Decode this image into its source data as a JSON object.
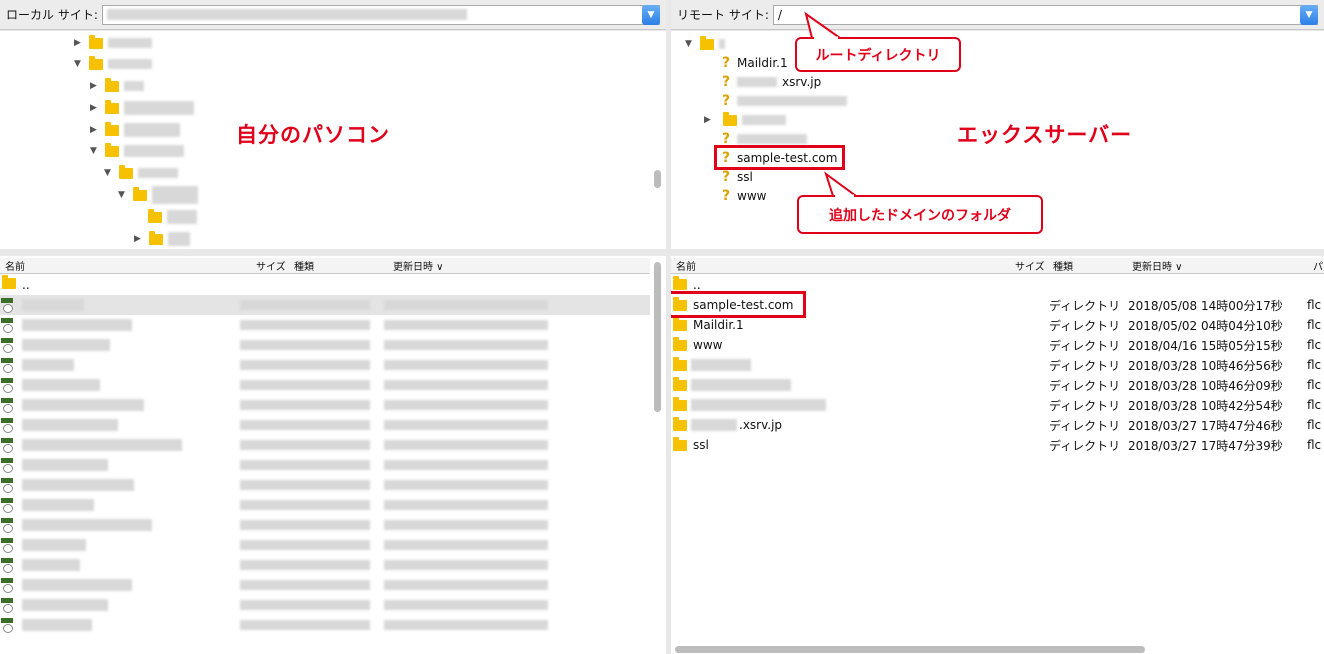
{
  "local": {
    "site_label": "ローカル サイト:",
    "headers": {
      "name": "名前",
      "size": "サイズ",
      "type": "種類",
      "modified": "更新日時 ∨"
    },
    "parent_entry": "..",
    "overlay_label": "自分のパソコン"
  },
  "remote": {
    "site_label": "リモート サイト:",
    "path": "/",
    "tree": [
      {
        "label": "Maildir.1"
      },
      {
        "label": "xsrv.jp"
      },
      {
        "label": "sample-test.com"
      },
      {
        "label": "ssl"
      },
      {
        "label": "www"
      }
    ],
    "headers": {
      "name": "名前",
      "size": "サイズ",
      "type": "種類",
      "modified": "更新日時 ∨",
      "perm": "パ"
    },
    "parent_entry": "..",
    "files": [
      {
        "name": "sample-test.com",
        "type": "ディレクトリ",
        "modified": "2018/05/08 14時00分17秒",
        "owner": "flc"
      },
      {
        "name": "Maildir.1",
        "type": "ディレクトリ",
        "modified": "2018/05/02 04時04分10秒",
        "owner": "flc"
      },
      {
        "name": "www",
        "type": "ディレクトリ",
        "modified": "2018/04/16 15時05分15秒",
        "owner": "flc"
      },
      {
        "name": "",
        "type": "ディレクトリ",
        "modified": "2018/03/28 10時46分56秒",
        "owner": "flc"
      },
      {
        "name": "",
        "type": "ディレクトリ",
        "modified": "2018/03/28 10時46分09秒",
        "owner": "flc"
      },
      {
        "name": "",
        "type": "ディレクトリ",
        "modified": "2018/03/28 10時42分54秒",
        "owner": "flc"
      },
      {
        "name": ".xsrv.jp",
        "type": "ディレクトリ",
        "modified": "2018/03/27 17時47分46秒",
        "owner": "flc"
      },
      {
        "name": "ssl",
        "type": "ディレクトリ",
        "modified": "2018/03/27 17時47分39秒",
        "owner": "flc"
      }
    ],
    "overlay_label": "エックスサーバー"
  },
  "annotations": {
    "root_dir": "ルートディレクトリ",
    "added_domain": "追加したドメインのフォルダ"
  },
  "colors": {
    "accent_red": "#e0001a",
    "folder": "#f6c200",
    "dropdown_blue": "#2a7fe8"
  }
}
